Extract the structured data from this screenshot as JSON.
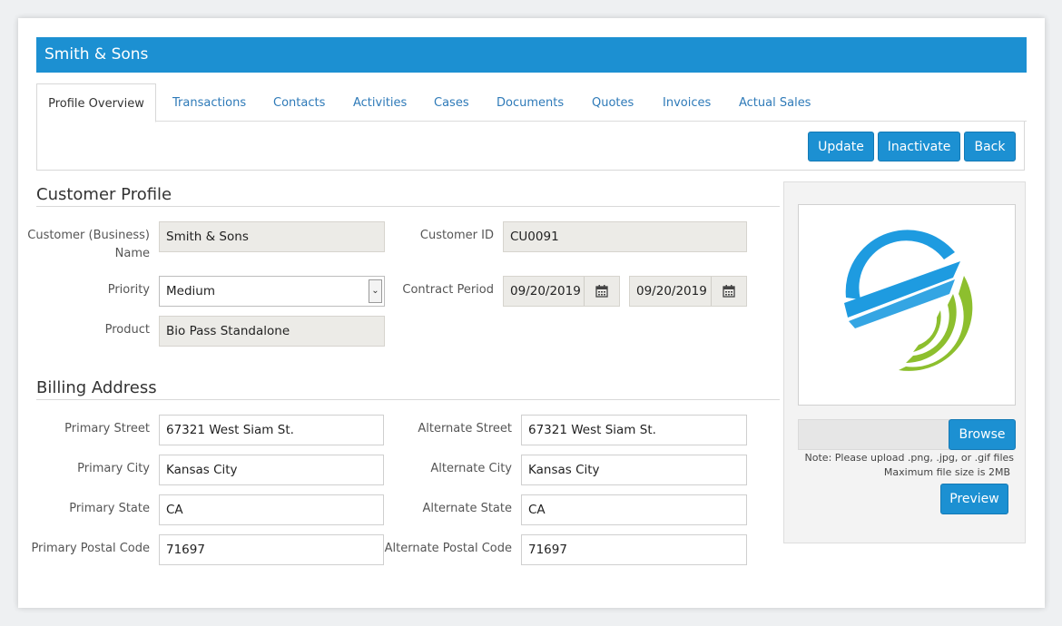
{
  "header": {
    "title": "Smith & Sons"
  },
  "tabs": [
    {
      "label": "Profile Overview",
      "active": true
    },
    {
      "label": "Transactions"
    },
    {
      "label": "Contacts"
    },
    {
      "label": "Activities"
    },
    {
      "label": "Cases"
    },
    {
      "label": "Documents"
    },
    {
      "label": "Quotes"
    },
    {
      "label": "Invoices"
    },
    {
      "label": "Actual Sales"
    }
  ],
  "toolbar": {
    "update_label": "Update",
    "inactivate_label": "Inactivate",
    "back_label": "Back"
  },
  "customer_profile": {
    "title": "Customer Profile",
    "name_label": "Customer (Business) Name",
    "name_value": "Smith & Sons",
    "id_label": "Customer ID",
    "id_value": "CU0091",
    "priority_label": "Priority",
    "priority_value": "Medium",
    "contract_label": "Contract Period",
    "contract_start": "09/20/2019",
    "contract_end": "09/20/2019",
    "product_label": "Product",
    "product_value": "Bio Pass Standalone"
  },
  "billing": {
    "title": "Billing Address",
    "primary_street_label": "Primary Street",
    "primary_street": "67321 West Siam St.",
    "alternate_street_label": "Alternate Street",
    "alternate_street": "67321 West Siam St.",
    "primary_city_label": "Primary City",
    "primary_city": "Kansas City",
    "alternate_city_label": "Alternate City",
    "alternate_city": "Kansas City",
    "primary_state_label": "Primary State",
    "primary_state": "CA",
    "alternate_state_label": "Alternate State",
    "alternate_state": "CA",
    "primary_postal_label": "Primary Postal Code",
    "primary_postal": "71697",
    "alternate_postal_label": "Alternate Postal Code",
    "alternate_postal": "71697"
  },
  "logo_panel": {
    "browse_label": "Browse",
    "note_line1": "Note: Please upload .png, .jpg, or .gif files",
    "note_line2": "Maximum file  size is 2MB",
    "preview_label": "Preview"
  },
  "colors": {
    "accent": "#1c90d2",
    "logo_blue": "#1e9be0",
    "logo_green": "#8dbf2e"
  }
}
